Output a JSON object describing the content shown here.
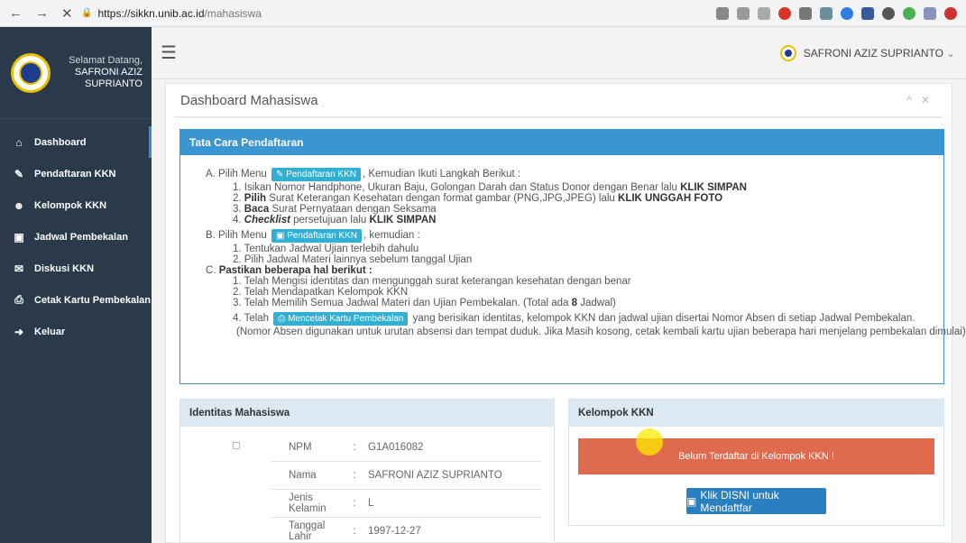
{
  "browser": {
    "back": "←",
    "forward": "→",
    "close": "✕",
    "url_host": "https://sikkn.unib.ac.id",
    "url_path": "/mahasiswa"
  },
  "sidebar": {
    "welcome": "Selamat Datang,",
    "user_name": "SAFRONI AZIZ SUPRIANTO",
    "items": [
      {
        "icon": "home-icon",
        "glyph": "⌂",
        "label": "Dashboard"
      },
      {
        "icon": "edit-icon",
        "glyph": "✎",
        "label": "Pendaftaran KKN"
      },
      {
        "icon": "users-icon",
        "glyph": "☻",
        "label": "Kelompok KKN"
      },
      {
        "icon": "calendar-icon",
        "glyph": "▣",
        "label": "Jadwal Pembekalan"
      },
      {
        "icon": "comments-icon",
        "glyph": "✉",
        "label": "Diskusi KKN"
      },
      {
        "icon": "print-icon",
        "glyph": "⎙",
        "label": "Cetak Kartu Pembekalan"
      },
      {
        "icon": "sign-out-icon",
        "glyph": "➜",
        "label": "Keluar"
      }
    ]
  },
  "topbar": {
    "user": "SAFRONI AZIZ SUPRIANTO",
    "caret": "⌄"
  },
  "panel": {
    "title": "Dashboard Mahasiswa",
    "collapse": "^",
    "close": "✕"
  },
  "tata_cara": {
    "header": "Tata Cara Pendaftaran",
    "a_prefix": "A. Pilih Menu",
    "a_button": "Pendaftaran KKN",
    "a_suffix": ", Kemudian Ikuti Langkah Berikut :",
    "a1_text": "1. Isikan Nomor Handphone, Ukuran Baju, Golongan Darah dan Status Donor dengan Benar lalu ",
    "a1_bold": "KLIK SIMPAN",
    "a2_pre": "2. ",
    "a2_bold1": "Pilih",
    "a2_text": " Surat Keterangan Kesehatan dengan format gambar (PNG,JPG,JPEG) lalu ",
    "a2_bold2": "KLIK UNGGAH FOTO",
    "a3_pre": "3. ",
    "a3_bold": "Baca",
    "a3_text": " Surat Pernyataan dengan Seksama",
    "a4_pre": "4. ",
    "a4_bold": "Checklist",
    "a4_text": " persetujuan lalu ",
    "a4_bold2": "KLIK SIMPAN",
    "b_prefix": "B. Pilih Menu",
    "b_button": "Pendaftaran KKN",
    "b_suffix": ", kemudian :",
    "b1": "1. Tentukan Jadwal Ujian terlebih dahulu",
    "b2": "2. Pilih Jadwal Materi lainnya sebelum tanggal Ujian",
    "c_prefix": "C. ",
    "c_bold": "Pastikan beberapa hal berikut :",
    "c1": "1. Telah Mengisi identitas dan mengunggah surat keterangan kesehatan dengan benar",
    "c2": "2. Telah Mendapatkan Kelompok KKN",
    "c3_text": "3. Telah Memilih Semua Jadwal Materi dan Ujian Pembekalan. (Total ada ",
    "c3_bold": "8",
    "c3_end": " Jadwal)",
    "c4_pre": "4. Telah",
    "c4_button": "Mencetak Kartu Pembekalan",
    "c4_text": " yang berisikan identitas, kelompok KKN dan jadwal ujian disertai Nomor Absen di setiap Jadwal Pembekalan.",
    "c_note": "(Nomor Absen digunakan untuk urutan absensi dan tempat duduk. Jika Masih kosong, cetak kembali kartu ujian beberapa hari menjelang pembekalan dimulai)"
  },
  "identitas": {
    "header": "Identitas Mahasiswa",
    "rows": [
      {
        "key": "NPM",
        "sep": ":",
        "value": "G1A016082"
      },
      {
        "key": "Nama",
        "sep": ":",
        "value": "SAFRONI AZIZ SUPRIANTO"
      },
      {
        "key": "Jenis Kelamin",
        "sep": ":",
        "value": "L"
      },
      {
        "key": "Tanggal Lahir",
        "sep": ":",
        "value": "1997-12-27"
      }
    ]
  },
  "kelompok": {
    "header": "Kelompok KKN",
    "alert": "Belum Terdaftar di Kelompok KKN !",
    "button": "Klik DISNI untuk Mendaftfar"
  },
  "colors": {
    "sidebar": "#2b3a4a",
    "primary": "#3a95d0",
    "danger": "#e06a4e",
    "info": "#31b0d5"
  }
}
